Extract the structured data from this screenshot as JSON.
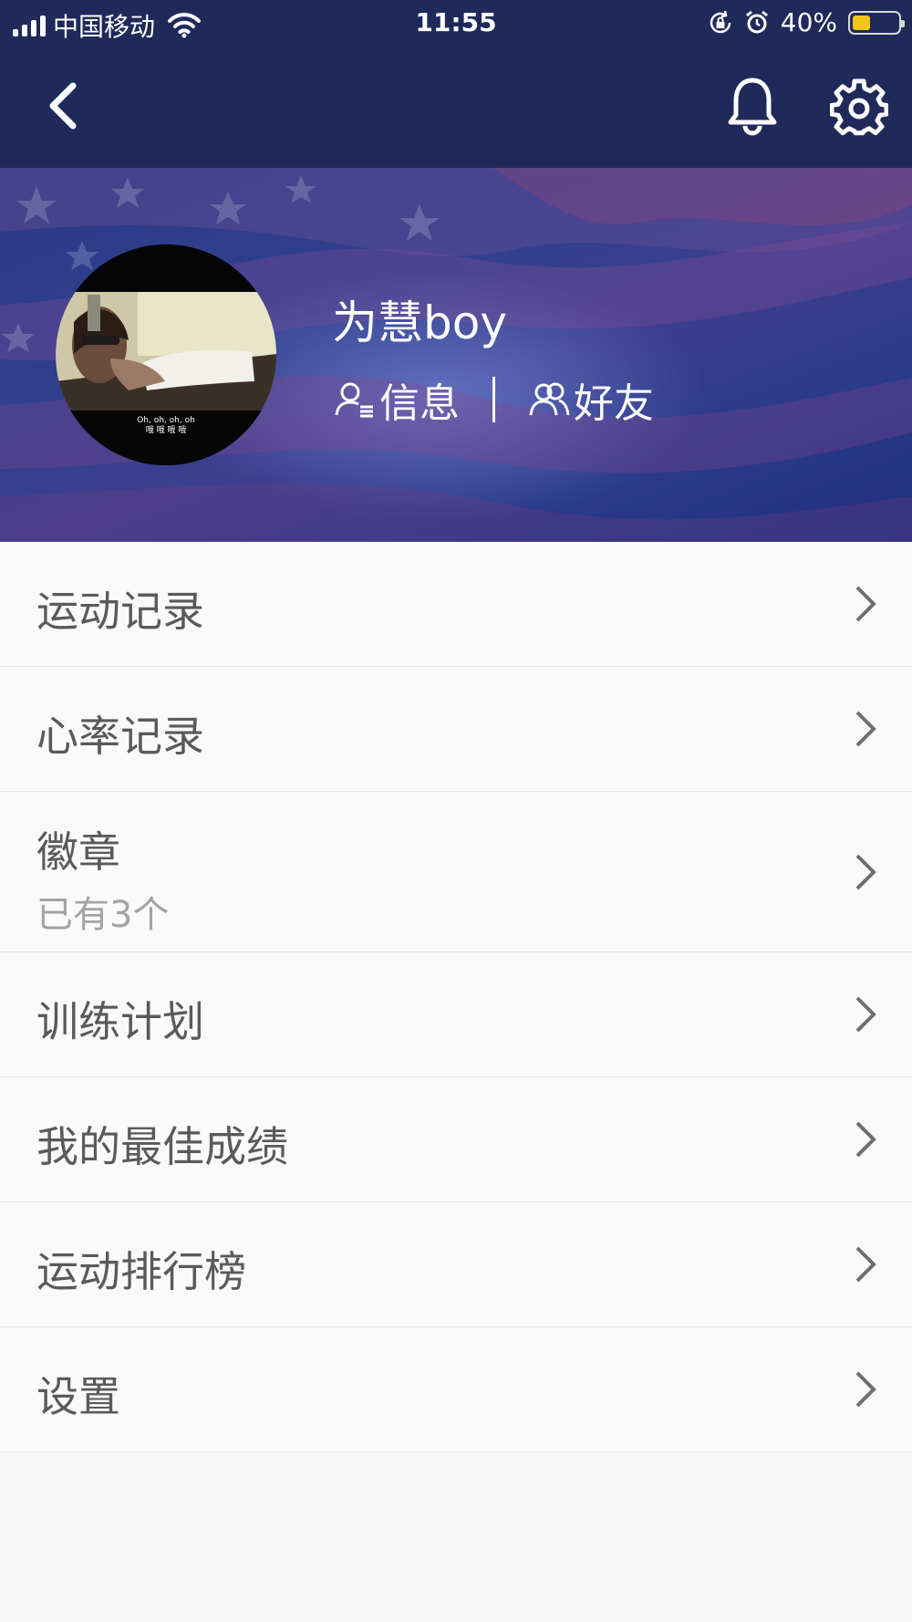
{
  "status_bar": {
    "carrier": "中国移动",
    "time": "11:55",
    "battery": "40%",
    "battery_level": 0.4
  },
  "nav": {
    "back_icon": "chevron-left-icon",
    "bell_icon": "bell-icon",
    "settings_icon": "gear-icon"
  },
  "profile": {
    "username": "为慧boy",
    "info_label": "信息",
    "friends_label": "好友",
    "avatar_caption_en": "Oh, oh, oh, oh",
    "avatar_caption_zh": "哦 哦 哦 哦"
  },
  "menu": {
    "items": [
      {
        "label": "运动记录",
        "sub": ""
      },
      {
        "label": "心率记录",
        "sub": ""
      },
      {
        "label": "徽章",
        "sub": "已有3个"
      },
      {
        "label": "训练计划",
        "sub": ""
      },
      {
        "label": "我的最佳成绩",
        "sub": ""
      },
      {
        "label": "运动排行榜",
        "sub": ""
      },
      {
        "label": "设置",
        "sub": ""
      }
    ]
  },
  "colors": {
    "header_bg": "#1f2a5a",
    "banner_bg": "#2f3d8c",
    "text_primary": "#5a5a5a",
    "text_secondary": "#a3a3a3",
    "battery_fill": "#f5c518"
  }
}
